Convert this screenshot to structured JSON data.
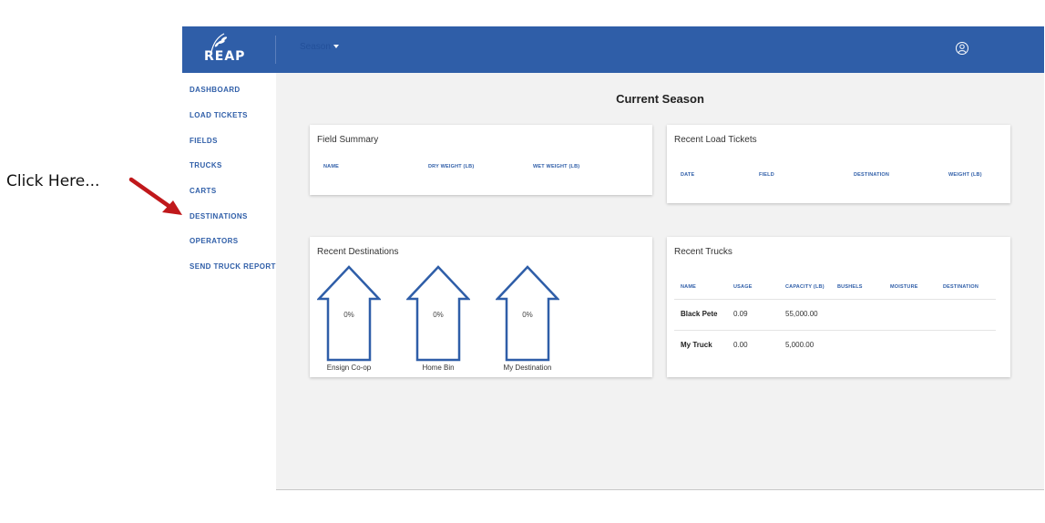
{
  "annotation": {
    "text": "Click Here...",
    "arrow_color": "#c0181b"
  },
  "colors": {
    "brand": "#2f5ea8",
    "background": "#f2f2f2"
  },
  "app": {
    "logo_text": "REAP",
    "season_menu_label": "Season",
    "user_icon": "user-circle-icon"
  },
  "sidebar": {
    "items": [
      {
        "label": "DASHBOARD"
      },
      {
        "label": "LOAD TICKETS"
      },
      {
        "label": "FIELDS"
      },
      {
        "label": "TRUCKS"
      },
      {
        "label": "CARTS"
      },
      {
        "label": "DESTINATIONS"
      },
      {
        "label": "OPERATORS"
      },
      {
        "label": "SEND TRUCK REPORT"
      }
    ]
  },
  "main": {
    "title": "Current Season",
    "field_summary": {
      "title": "Field Summary",
      "columns": [
        "NAME",
        "DRY WEIGHT (LB)",
        "WET WEIGHT (LB)"
      ]
    },
    "recent_load_tickets": {
      "title": "Recent Load Tickets",
      "columns": [
        "DATE",
        "FIELD",
        "DESTINATION",
        "WEIGHT (LB)"
      ]
    },
    "recent_destinations": {
      "title": "Recent Destinations",
      "items": [
        {
          "name": "Ensign Co-op",
          "percent": "0%"
        },
        {
          "name": "Home Bin",
          "percent": "0%"
        },
        {
          "name": "My Destination",
          "percent": "0%"
        }
      ]
    },
    "recent_trucks": {
      "title": "Recent Trucks",
      "columns": [
        "NAME",
        "USAGE",
        "CAPACITY (LB)",
        "BUSHELS",
        "MOISTURE",
        "DESTINATION"
      ],
      "rows": [
        {
          "name": "Black Pete",
          "usage": "0.09",
          "capacity": "55,000.00"
        },
        {
          "name": "My Truck",
          "usage": "0.00",
          "capacity": "5,000.00"
        }
      ]
    }
  }
}
